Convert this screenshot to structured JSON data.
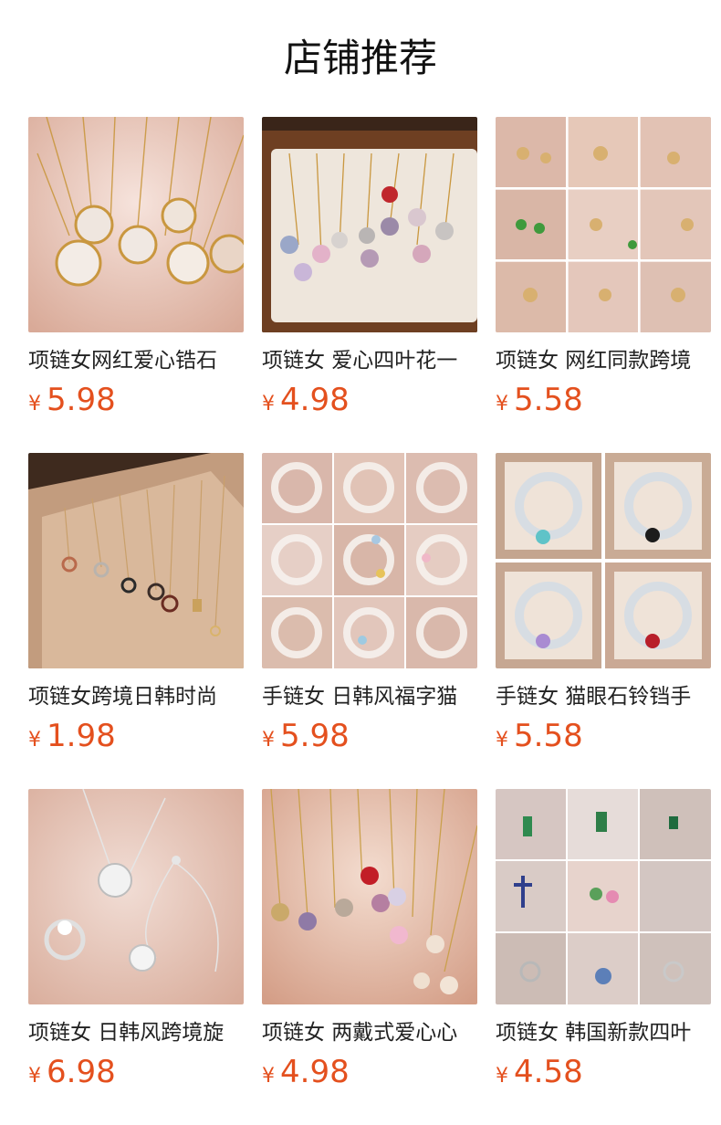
{
  "page": {
    "title": "店铺推荐"
  },
  "products": [
    {
      "name": "项链女网红爱心锆石",
      "currency": "¥",
      "price": "5.98",
      "image": "four-leaf-clover-necklaces-photo"
    },
    {
      "name": "项链女 爱心四叶花一",
      "currency": "¥",
      "price": "4.98",
      "image": "clover-necklaces-in-tray-photo"
    },
    {
      "name": "项链女 网红同款跨境",
      "currency": "¥",
      "price": "5.58",
      "image": "jewelry-collage-photo"
    },
    {
      "name": "项链女跨境日韩时尚",
      "currency": "¥",
      "price": "1.98",
      "image": "ring-pendant-necklaces-photo"
    },
    {
      "name": "手链女 日韩风福字猫",
      "currency": "¥",
      "price": "5.98",
      "image": "beaded-bracelets-collage-photo"
    },
    {
      "name": "手链女 猫眼石铃铛手",
      "currency": "¥",
      "price": "5.58",
      "image": "cat-eye-bracelets-in-boxes-photo"
    },
    {
      "name": "项链女 日韩风跨境旋",
      "currency": "¥",
      "price": "6.98",
      "image": "silver-clover-set-photo"
    },
    {
      "name": "项链女 两戴式爱心心",
      "currency": "¥",
      "price": "4.98",
      "image": "heart-clover-necklaces-photo"
    },
    {
      "name": "项链女 韩国新款四叶",
      "currency": "¥",
      "price": "4.58",
      "image": "necklace-collage-photo"
    }
  ],
  "colors": {
    "price": "#e4501e",
    "text": "#222222",
    "title": "#111111"
  }
}
